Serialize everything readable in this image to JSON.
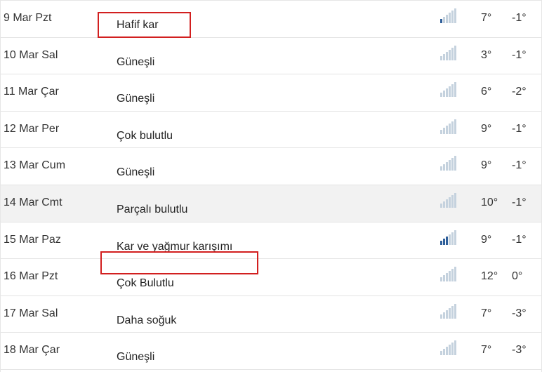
{
  "forecast": {
    "rows": [
      {
        "date": "9 Mar Pzt",
        "condition": "Hafif kar",
        "high": "7°",
        "low": "-1°",
        "precip_level": 1,
        "highlighted": true,
        "shaded": false
      },
      {
        "date": "10 Mar Sal",
        "condition": "Güneşli",
        "high": "3°",
        "low": "-1°",
        "precip_level": 0,
        "highlighted": false,
        "shaded": false
      },
      {
        "date": "11 Mar Çar",
        "condition": "Güneşli",
        "high": "6°",
        "low": "-2°",
        "precip_level": 0,
        "highlighted": false,
        "shaded": false
      },
      {
        "date": "12 Mar Per",
        "condition": "Çok bulutlu",
        "high": "9°",
        "low": "-1°",
        "precip_level": 0,
        "highlighted": false,
        "shaded": false
      },
      {
        "date": "13 Mar Cum",
        "condition": "Güneşli",
        "high": "9°",
        "low": "-1°",
        "precip_level": 0,
        "highlighted": false,
        "shaded": false
      },
      {
        "date": "14 Mar Cmt",
        "condition": "Parçalı bulutlu",
        "high": "10°",
        "low": "-1°",
        "precip_level": 0,
        "highlighted": false,
        "shaded": true
      },
      {
        "date": "15 Mar Paz",
        "condition": "Kar ve yağmur karışımı",
        "high": "9°",
        "low": "-1°",
        "precip_level": 3,
        "highlighted": true,
        "shaded": false
      },
      {
        "date": "16 Mar Pzt",
        "condition": "Çok Bulutlu",
        "high": "12°",
        "low": "0°",
        "precip_level": 0,
        "highlighted": false,
        "shaded": false
      },
      {
        "date": "17 Mar Sal",
        "condition": "Daha soğuk",
        "high": "7°",
        "low": "-3°",
        "precip_level": 0,
        "highlighted": false,
        "shaded": false
      },
      {
        "date": "18 Mar Çar",
        "condition": "Güneşli",
        "high": "7°",
        "low": "-3°",
        "precip_level": 0,
        "highlighted": false,
        "shaded": false
      }
    ]
  },
  "colors": {
    "highlight_border": "#d21f1f",
    "bar_active": "#2f5f9a",
    "bar_inactive": "#c5d2de",
    "row_shaded": "#f2f2f2"
  },
  "icons": {
    "precip": "signal-bars-icon"
  }
}
